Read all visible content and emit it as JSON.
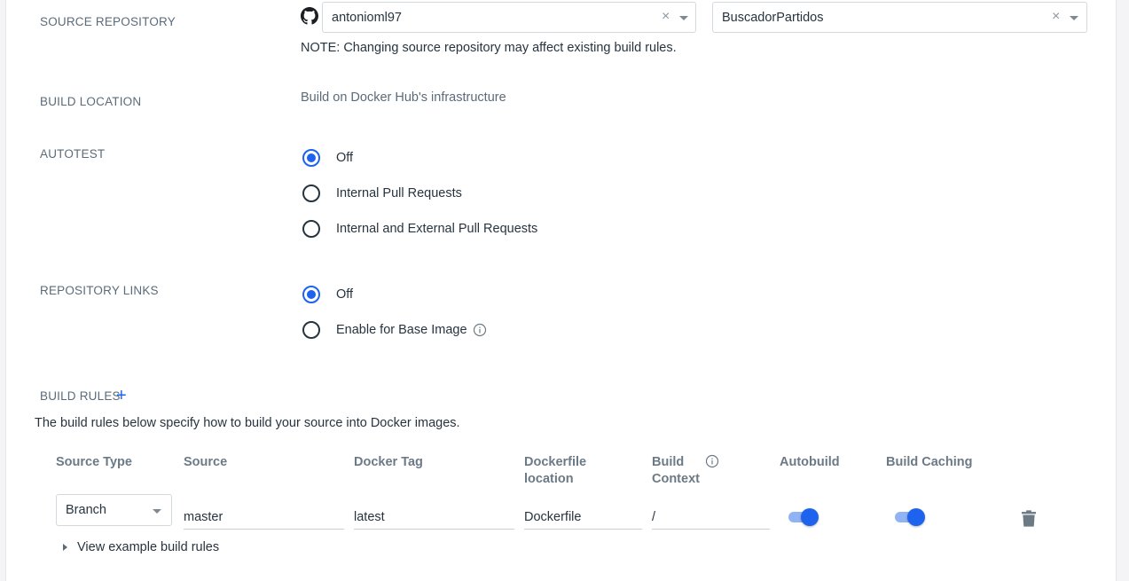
{
  "source_repository": {
    "label": "SOURCE REPOSITORY",
    "organization": "antonioml97",
    "repository": "BuscadorPartidos",
    "clear_glyph": "×",
    "note": "NOTE: Changing source repository may affect existing build rules.",
    "icon": "github-icon"
  },
  "build_location": {
    "label": "BUILD LOCATION",
    "value": "Build on Docker Hub's infrastructure"
  },
  "autotest": {
    "label": "AUTOTEST",
    "options": [
      {
        "label": "Off",
        "checked": true
      },
      {
        "label": "Internal Pull Requests",
        "checked": false
      },
      {
        "label": "Internal and External Pull Requests",
        "checked": false
      }
    ]
  },
  "repository_links": {
    "label": "REPOSITORY LINKS",
    "options": [
      {
        "label": "Off",
        "checked": true
      },
      {
        "label": "Enable for Base Image",
        "checked": false
      }
    ]
  },
  "build_rules": {
    "label": "BUILD RULES",
    "add_glyph": "+",
    "description": "The build rules below specify how to build your source into Docker images.",
    "columns": {
      "source_type": "Source Type",
      "source": "Source",
      "docker_tag": "Docker Tag",
      "dockerfile_location_1": "Dockerfile",
      "dockerfile_location_2": "location",
      "build_context_1": "Build",
      "build_context_2": "Context",
      "autobuild": "Autobuild",
      "build_caching": "Build Caching"
    },
    "rule": {
      "source_type": "Branch",
      "source": "master",
      "docker_tag": "latest",
      "dockerfile_location": "Dockerfile",
      "build_context": "/",
      "autobuild": true,
      "build_caching": true
    },
    "example_link": "View example build rules"
  },
  "colors": {
    "accent": "#1d63ed",
    "label": "#5b6b7a",
    "text": "#27343f"
  }
}
